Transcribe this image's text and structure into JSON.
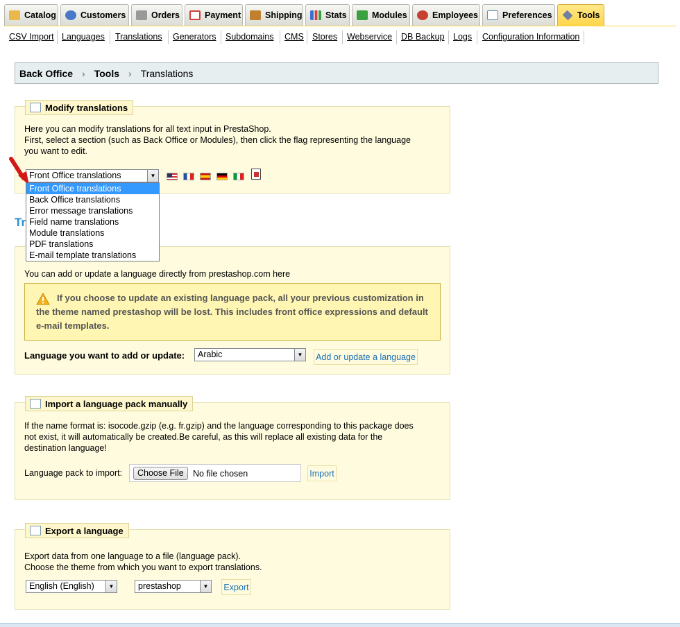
{
  "tabs": [
    {
      "label": "Catalog",
      "icon": "folder-icon",
      "color": "#e8b84a"
    },
    {
      "label": "Customers",
      "icon": "customer-icon",
      "color": "#4a78c8"
    },
    {
      "label": "Orders",
      "icon": "cart-icon",
      "color": "#888888"
    },
    {
      "label": "Payment",
      "icon": "payment-icon",
      "color": "#d04040"
    },
    {
      "label": "Shipping",
      "icon": "truck-icon",
      "color": "#c08030"
    },
    {
      "label": "Stats",
      "icon": "stats-icon",
      "color": "#3a70d0"
    },
    {
      "label": "Modules",
      "icon": "puzzle-icon",
      "color": "#3aa040"
    },
    {
      "label": "Employees",
      "icon": "employee-icon",
      "color": "#c84030"
    },
    {
      "label": "Preferences",
      "icon": "preferences-icon",
      "color": "#5a8ab0"
    },
    {
      "label": "Tools",
      "icon": "wrench-icon",
      "color": "#7080a0"
    }
  ],
  "subnav": [
    "CSV Import",
    "Languages",
    "Translations",
    "Generators",
    "Subdomains",
    "CMS",
    "Stores",
    "Webservice",
    "DB Backup",
    "Logs",
    "Configuration Information"
  ],
  "breadcrumb": {
    "root": "Back Office",
    "section": "Tools",
    "page": "Translations",
    "separator": "›"
  },
  "modify": {
    "legend": "Modify translations",
    "line1": "Here you can modify translations for all text input in PrestaShop.",
    "line2": "First, select a section (such as Back Office or Modules), then click the flag representing the language",
    "line3": "you want to edit.",
    "selected": "Front Office translations",
    "options": [
      "Front Office translations",
      "Back Office translations",
      "Error message translations",
      "Field name translations",
      "Module translations",
      "PDF translations",
      "E-mail template translations"
    ]
  },
  "hidden_heading": "Tr",
  "addupdate": {
    "intro": "You can add or update a language directly from prestashop.com here",
    "warning": "If you choose to update an existing language pack, all your previous customization in the theme named prestashop will be lost. This includes front office expressions and default e-mail templates.",
    "label": "Language you want to add or update:",
    "selected": "Arabic",
    "button": "Add or update a language"
  },
  "import": {
    "legend": "Import a language pack manually",
    "line1": "If the name format is: isocode.gzip (e.g. fr.gzip) and the language corresponding to this package does",
    "line2": "not exist, it will automatically be created.Be careful, as this will replace all existing data for the",
    "line3": "destination language!",
    "label": "Language pack to import:",
    "choose": "Choose File",
    "nofile": "No file chosen",
    "button": "Import"
  },
  "export": {
    "legend": "Export a language",
    "line1": "Export data from one language to a file (language pack).",
    "line2": "Choose the theme from which you want to export translations.",
    "language": "English (English)",
    "theme": "prestashop",
    "button": "Export"
  },
  "colors": {
    "accent": "#ffd54a",
    "link": "#1a6fb5",
    "heading": "#2a8fd0",
    "panel": "#fffbdf",
    "highlight": "#3399ff"
  }
}
